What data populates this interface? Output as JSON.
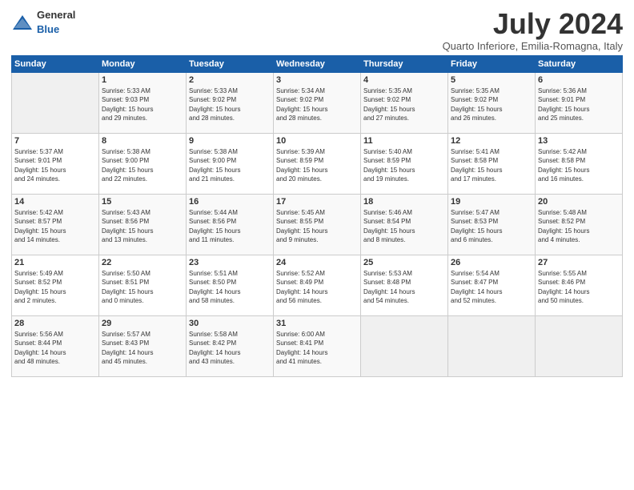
{
  "header": {
    "logo_general": "General",
    "logo_blue": "Blue",
    "month": "July 2024",
    "location": "Quarto Inferiore, Emilia-Romagna, Italy"
  },
  "weekdays": [
    "Sunday",
    "Monday",
    "Tuesday",
    "Wednesday",
    "Thursday",
    "Friday",
    "Saturday"
  ],
  "weeks": [
    [
      {
        "day": "",
        "info": ""
      },
      {
        "day": "1",
        "info": "Sunrise: 5:33 AM\nSunset: 9:03 PM\nDaylight: 15 hours\nand 29 minutes."
      },
      {
        "day": "2",
        "info": "Sunrise: 5:33 AM\nSunset: 9:02 PM\nDaylight: 15 hours\nand 28 minutes."
      },
      {
        "day": "3",
        "info": "Sunrise: 5:34 AM\nSunset: 9:02 PM\nDaylight: 15 hours\nand 28 minutes."
      },
      {
        "day": "4",
        "info": "Sunrise: 5:35 AM\nSunset: 9:02 PM\nDaylight: 15 hours\nand 27 minutes."
      },
      {
        "day": "5",
        "info": "Sunrise: 5:35 AM\nSunset: 9:02 PM\nDaylight: 15 hours\nand 26 minutes."
      },
      {
        "day": "6",
        "info": "Sunrise: 5:36 AM\nSunset: 9:01 PM\nDaylight: 15 hours\nand 25 minutes."
      }
    ],
    [
      {
        "day": "7",
        "info": "Sunrise: 5:37 AM\nSunset: 9:01 PM\nDaylight: 15 hours\nand 24 minutes."
      },
      {
        "day": "8",
        "info": "Sunrise: 5:38 AM\nSunset: 9:00 PM\nDaylight: 15 hours\nand 22 minutes."
      },
      {
        "day": "9",
        "info": "Sunrise: 5:38 AM\nSunset: 9:00 PM\nDaylight: 15 hours\nand 21 minutes."
      },
      {
        "day": "10",
        "info": "Sunrise: 5:39 AM\nSunset: 8:59 PM\nDaylight: 15 hours\nand 20 minutes."
      },
      {
        "day": "11",
        "info": "Sunrise: 5:40 AM\nSunset: 8:59 PM\nDaylight: 15 hours\nand 19 minutes."
      },
      {
        "day": "12",
        "info": "Sunrise: 5:41 AM\nSunset: 8:58 PM\nDaylight: 15 hours\nand 17 minutes."
      },
      {
        "day": "13",
        "info": "Sunrise: 5:42 AM\nSunset: 8:58 PM\nDaylight: 15 hours\nand 16 minutes."
      }
    ],
    [
      {
        "day": "14",
        "info": "Sunrise: 5:42 AM\nSunset: 8:57 PM\nDaylight: 15 hours\nand 14 minutes."
      },
      {
        "day": "15",
        "info": "Sunrise: 5:43 AM\nSunset: 8:56 PM\nDaylight: 15 hours\nand 13 minutes."
      },
      {
        "day": "16",
        "info": "Sunrise: 5:44 AM\nSunset: 8:56 PM\nDaylight: 15 hours\nand 11 minutes."
      },
      {
        "day": "17",
        "info": "Sunrise: 5:45 AM\nSunset: 8:55 PM\nDaylight: 15 hours\nand 9 minutes."
      },
      {
        "day": "18",
        "info": "Sunrise: 5:46 AM\nSunset: 8:54 PM\nDaylight: 15 hours\nand 8 minutes."
      },
      {
        "day": "19",
        "info": "Sunrise: 5:47 AM\nSunset: 8:53 PM\nDaylight: 15 hours\nand 6 minutes."
      },
      {
        "day": "20",
        "info": "Sunrise: 5:48 AM\nSunset: 8:52 PM\nDaylight: 15 hours\nand 4 minutes."
      }
    ],
    [
      {
        "day": "21",
        "info": "Sunrise: 5:49 AM\nSunset: 8:52 PM\nDaylight: 15 hours\nand 2 minutes."
      },
      {
        "day": "22",
        "info": "Sunrise: 5:50 AM\nSunset: 8:51 PM\nDaylight: 15 hours\nand 0 minutes."
      },
      {
        "day": "23",
        "info": "Sunrise: 5:51 AM\nSunset: 8:50 PM\nDaylight: 14 hours\nand 58 minutes."
      },
      {
        "day": "24",
        "info": "Sunrise: 5:52 AM\nSunset: 8:49 PM\nDaylight: 14 hours\nand 56 minutes."
      },
      {
        "day": "25",
        "info": "Sunrise: 5:53 AM\nSunset: 8:48 PM\nDaylight: 14 hours\nand 54 minutes."
      },
      {
        "day": "26",
        "info": "Sunrise: 5:54 AM\nSunset: 8:47 PM\nDaylight: 14 hours\nand 52 minutes."
      },
      {
        "day": "27",
        "info": "Sunrise: 5:55 AM\nSunset: 8:46 PM\nDaylight: 14 hours\nand 50 minutes."
      }
    ],
    [
      {
        "day": "28",
        "info": "Sunrise: 5:56 AM\nSunset: 8:44 PM\nDaylight: 14 hours\nand 48 minutes."
      },
      {
        "day": "29",
        "info": "Sunrise: 5:57 AM\nSunset: 8:43 PM\nDaylight: 14 hours\nand 45 minutes."
      },
      {
        "day": "30",
        "info": "Sunrise: 5:58 AM\nSunset: 8:42 PM\nDaylight: 14 hours\nand 43 minutes."
      },
      {
        "day": "31",
        "info": "Sunrise: 6:00 AM\nSunset: 8:41 PM\nDaylight: 14 hours\nand 41 minutes."
      },
      {
        "day": "",
        "info": ""
      },
      {
        "day": "",
        "info": ""
      },
      {
        "day": "",
        "info": ""
      }
    ]
  ]
}
